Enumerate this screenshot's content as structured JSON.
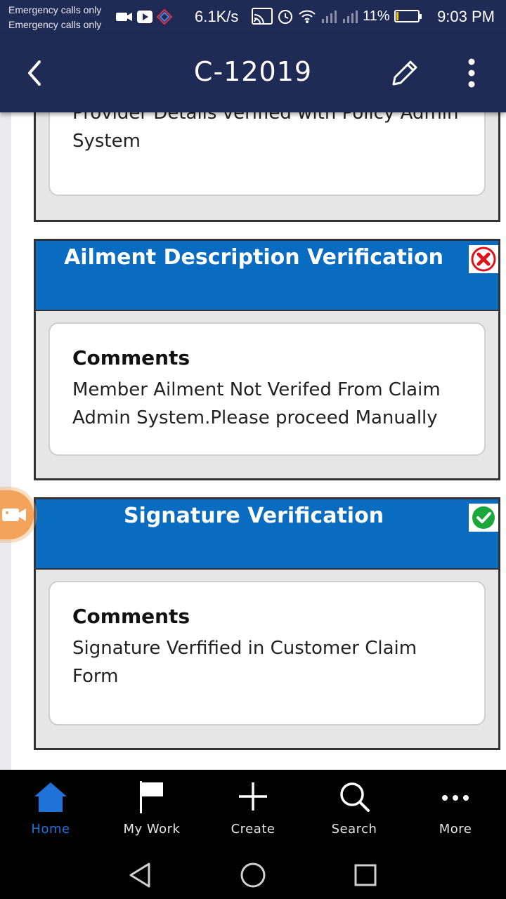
{
  "status_bar": {
    "carrier_line1": "Emergency calls only",
    "carrier_line2": "Emergency calls only",
    "network_rate": "6.1K/s",
    "battery": "11%",
    "battery_level": 0.11,
    "time": "9:03 PM"
  },
  "app_bar": {
    "title": "C-12019",
    "back_icon": "chevron-left-icon",
    "edit_icon": "pencil-icon",
    "more_icon": "vertical-dots-icon"
  },
  "panels": [
    {
      "card_text": "Provider Details verified with Policy Admin System"
    },
    {
      "header": "Ailment Description Verification",
      "status": "failed",
      "status_icon": "red-x-icon",
      "card_title": "Comments",
      "card_text": "Member Ailment Not Verifed From Claim Admin System.Please proceed Manually"
    },
    {
      "header": "Signature Verification",
      "status": "verified",
      "status_icon": "green-check-icon",
      "card_title": "Comments",
      "card_text": "Signature Verfified in Customer Claim Form"
    }
  ],
  "bottom_nav": {
    "items": [
      {
        "label": "Home",
        "icon": "home-icon",
        "active": true
      },
      {
        "label": "My Work",
        "icon": "flag-icon",
        "active": false
      },
      {
        "label": "Create",
        "icon": "plus-icon",
        "active": false
      },
      {
        "label": "Search",
        "icon": "search-icon",
        "active": false
      },
      {
        "label": "More",
        "icon": "more-horizontal-icon",
        "active": false
      }
    ]
  },
  "colors": {
    "app_bar": "#1f2a55",
    "panel_header": "#0a6cc1",
    "active_nav": "#1f73d8",
    "fail": "#e0101a",
    "success": "#1aa83a"
  }
}
